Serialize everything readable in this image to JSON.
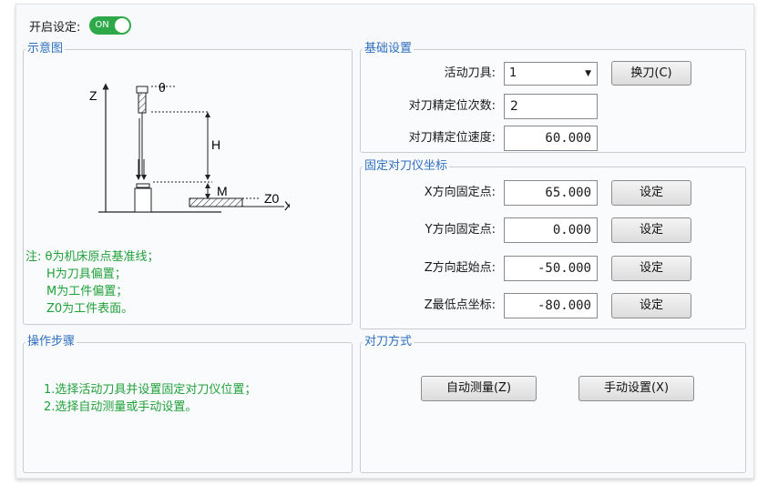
{
  "header": {
    "enable_label": "开启设定:",
    "toggle_text": "ON"
  },
  "diagram_panel": {
    "title": "示意图",
    "labels": {
      "z_axis": "Z",
      "theta": "θ",
      "h": "H",
      "m": "M",
      "z0": "Z0",
      "x_axis": "X"
    },
    "note_lines": [
      "注: θ为机床原点基准线；",
      "H为刀具偏置；",
      "M为工件偏置；",
      "Z0为工件表面。"
    ]
  },
  "basic_settings": {
    "title": "基础设置",
    "active_tool_label": "活动刀具:",
    "active_tool_value": "1",
    "change_tool_button": "换刀(C)",
    "precise_count_label": "对刀精定位次数:",
    "precise_count_value": "2",
    "precise_speed_label": "对刀精定位速度:",
    "precise_speed_value": "60.000"
  },
  "fixed_coords": {
    "title": "固定对刀仪坐标",
    "rows": [
      {
        "label": "X方向固定点:",
        "value": "65.000",
        "button": "设定"
      },
      {
        "label": "Y方向固定点:",
        "value": "0.000",
        "button": "设定"
      },
      {
        "label": "Z方向起始点:",
        "value": "-50.000",
        "button": "设定"
      },
      {
        "label": "Z最低点坐标:",
        "value": "-80.000",
        "button": "设定"
      }
    ]
  },
  "steps": {
    "title": "操作步骤",
    "lines": [
      "1.选择活动刀具并设置固定对刀仪位置；",
      "2.选择自动测量或手动设置。"
    ]
  },
  "method": {
    "title": "对刀方式",
    "auto_button": "自动测量(Z)",
    "manual_button": "手动设置(X)"
  },
  "colors": {
    "accent": "#2f6fbf",
    "note_green": "#21a03b",
    "toggle_green": "#2fa84a"
  }
}
